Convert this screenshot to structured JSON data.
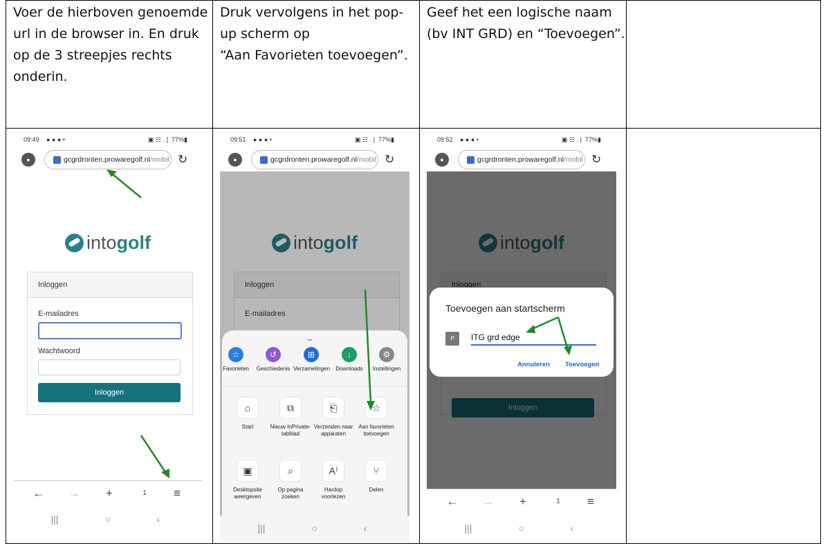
{
  "instructions": [
    "Voer de hierboven genoemde url in de browser in. En druk op de 3 streepjes rechts onderin.",
    "Druk vervolgens in het pop-up scherm op\n “Aan Favorieten toevoegen”.",
    "Geef het een logische naam (bv INT GRD) en “Toevoegen”.",
    ""
  ],
  "screens": [
    {
      "time": "09:49",
      "status_icons": "● ● ●  •",
      "battery": "▣ ☷ .❘ 77%▮"
    },
    {
      "time": "09:51",
      "status_icons": "● ● ●  •",
      "battery": "▣ ☷ .❘ 77%▮"
    },
    {
      "time": "09:52",
      "status_icons": "● ● ●  •",
      "battery": "▣ ☷ .❘ 77%▮"
    }
  ],
  "browser": {
    "url_domain": "gcgrdronten.prowaregolf.nl",
    "url_rest": "/mobil",
    "reload_icon": "reload-icon",
    "avatar_icon": "avatar-icon"
  },
  "login": {
    "logo_text_light": "into",
    "logo_text_bold": "golf",
    "heading": "Inloggen",
    "email_label": "E-mailadres",
    "password_label": "Wachtwoord",
    "button": "Inloggen"
  },
  "bottom_nav": {
    "back": "←",
    "forward": "→",
    "new_tab": "+",
    "tabs": "1",
    "menu": "≡"
  },
  "system_nav": {
    "recents": "|||",
    "home": "○",
    "back": "‹"
  },
  "menu": {
    "quick_actions": [
      {
        "label": "Favorieten",
        "color": "#2d7de0",
        "glyph": "☆"
      },
      {
        "label": "Geschiedenis",
        "color": "#8e57d8",
        "glyph": "↺"
      },
      {
        "label": "Verzamelingen",
        "color": "#1f6fd0",
        "glyph": "⊞"
      },
      {
        "label": "Downloads",
        "color": "#16a064",
        "glyph": "↓"
      },
      {
        "label": "Instellingen",
        "color": "#888888",
        "glyph": "⚙"
      }
    ],
    "tiles": [
      {
        "label": "Start",
        "glyph": "⌂"
      },
      {
        "label": "Nieuw InPrivate-tabblad",
        "glyph": "⧉"
      },
      {
        "label": "Verzenden naar apparaten",
        "glyph": "⎗"
      },
      {
        "label": "Aan favorieten toevoegen",
        "glyph": "☆"
      },
      {
        "label": "Desktopsite weergeven",
        "glyph": "▣"
      },
      {
        "label": "Op pagina zoeken",
        "glyph": "⌕"
      },
      {
        "label": "Hardop voorlezen",
        "glyph": "A⁾"
      },
      {
        "label": "Delen",
        "glyph": "⑂"
      }
    ]
  },
  "dialog": {
    "title": "Toevoegen aan startscherm",
    "icon_letter": "P",
    "name_value": "ITG grd edge",
    "cancel": "Annuleren",
    "confirm": "Toevoegen"
  },
  "colors": {
    "annotation_arrow": "#1f8a22",
    "brand_teal": "#14737e",
    "link_blue": "#1a66d8"
  }
}
